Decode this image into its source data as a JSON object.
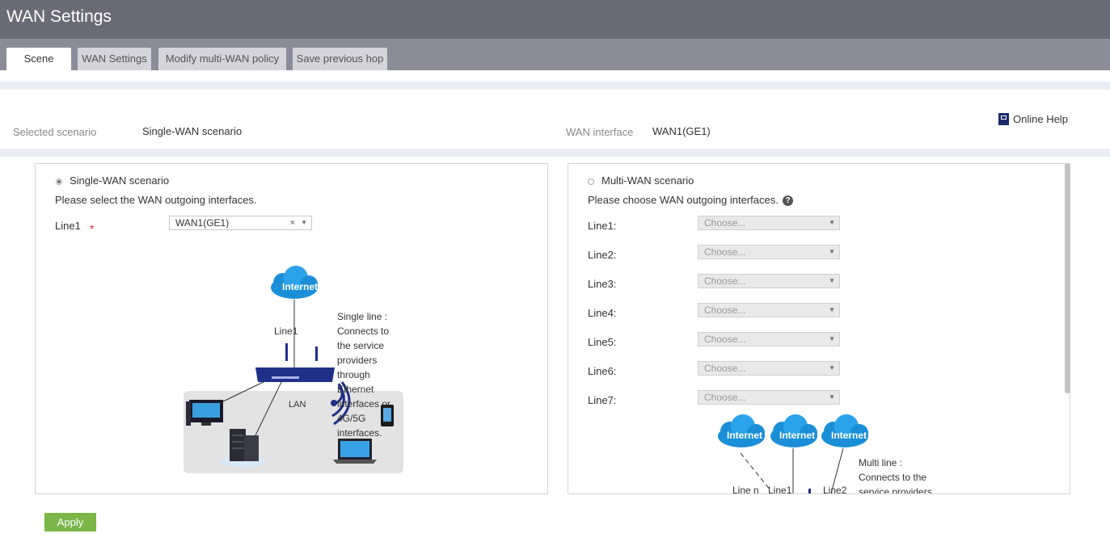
{
  "header": {
    "title": "WAN Settings"
  },
  "tabs": [
    {
      "label": "Scene",
      "active": true
    },
    {
      "label": "WAN Settings",
      "active": false
    },
    {
      "label": "Modify multi-WAN policy",
      "active": false
    },
    {
      "label": "Save previous hop",
      "active": false
    }
  ],
  "summary": {
    "selected_scenario_label": "Selected scenario",
    "selected_scenario_value": "Single-WAN scenario",
    "wan_interface_label": "WAN interface",
    "wan_interface_value": "WAN1(GE1)",
    "online_help": "Online Help"
  },
  "single": {
    "radio_label": "Single-WAN scenario",
    "selected": true,
    "instruction": "Please select the WAN outgoing interfaces.",
    "line_label": "Line1",
    "required_mark": "*",
    "line_value": "WAN1(GE1)",
    "clear_glyph": "×",
    "diagram": {
      "cloud_label": "Internet",
      "line_label": "Line1",
      "lan_label": "LAN",
      "description": "Single line : Connects to the service providers through Ethernet interfaces or 4G/5G interfaces."
    }
  },
  "multi": {
    "radio_label": "Multi-WAN scenario",
    "selected": false,
    "instruction": "Please choose WAN outgoing interfaces.",
    "help_glyph": "?",
    "lines": [
      {
        "label": "Line1:",
        "placeholder": "Choose..."
      },
      {
        "label": "Line2:",
        "placeholder": "Choose..."
      },
      {
        "label": "Line3:",
        "placeholder": "Choose..."
      },
      {
        "label": "Line4:",
        "placeholder": "Choose..."
      },
      {
        "label": "Line5:",
        "placeholder": "Choose..."
      },
      {
        "label": "Line6:",
        "placeholder": "Choose..."
      },
      {
        "label": "Line7:",
        "placeholder": "Choose..."
      }
    ],
    "diagram": {
      "cloud_label": "Internet",
      "line_n": "Line n",
      "line_1": "Line1",
      "line_2": "Line2",
      "description": "Multi line : Connects to the service providers"
    }
  },
  "actions": {
    "apply": "Apply"
  },
  "colors": {
    "header_bg": "#6b6b78",
    "tab_bar_bg": "#8c8b98",
    "apply_bg": "#7ab648",
    "required": "#e03030",
    "device_blue": "#1f2f8a",
    "cloud_blue": "#1a8fd8"
  }
}
